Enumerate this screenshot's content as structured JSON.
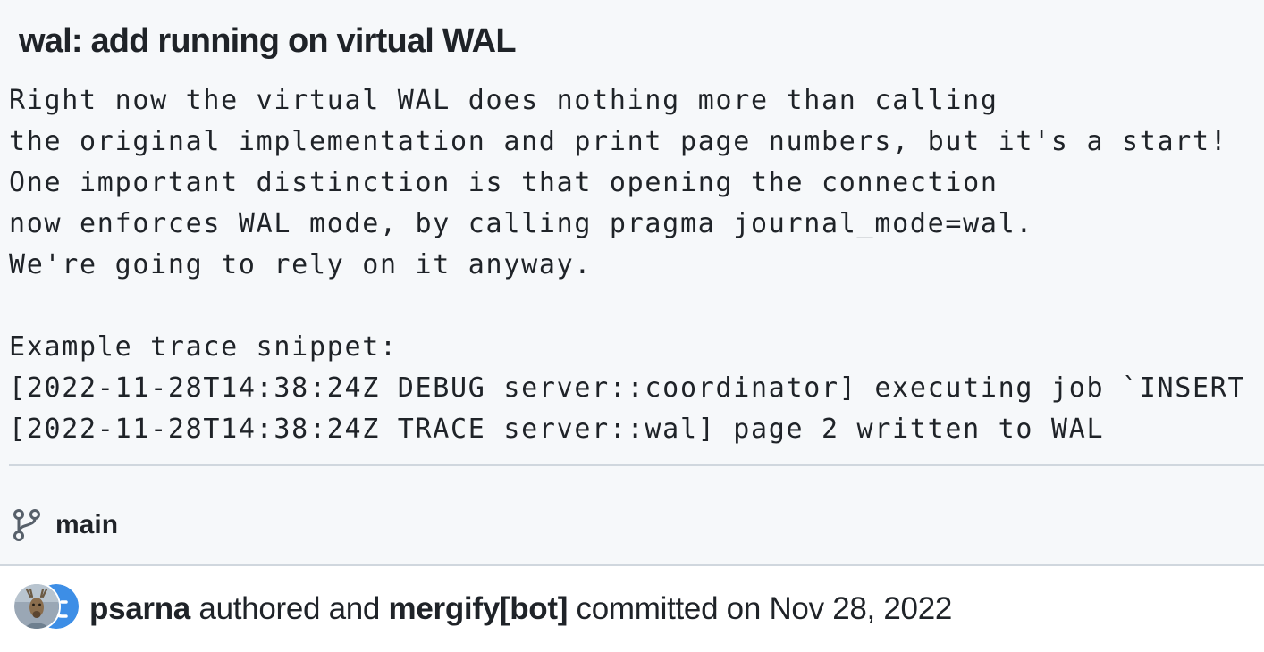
{
  "commit": {
    "title": "wal: add running on virtual WAL",
    "description_lines": [
      "Right now the virtual WAL does nothing more than calling",
      "the original implementation and print page numbers, but it's a start!",
      "One important distinction is that opening the connection",
      "now enforces WAL mode, by calling pragma journal_mode=wal.",
      "We're going to rely on it anyway.",
      "",
      "Example trace snippet:",
      "[2022-11-28T14:38:24Z DEBUG server::coordinator] executing job `INSERT",
      "[2022-11-28T14:38:24Z TRACE server::wal] page 2 written to WAL"
    ],
    "branch": "main",
    "author": "psarna",
    "authored_text": " authored and ",
    "committer": "mergify[bot]",
    "committed_text": " committed on ",
    "date": "Nov 28, 2022"
  },
  "icons": {
    "branch": "git-branch-icon",
    "author_avatar": "psarna-avatar",
    "committer_avatar": "mergify-bot-avatar"
  },
  "colors": {
    "header_background": "#f6f8fa",
    "author_bar_background": "#ffffff",
    "border": "#d0d7de",
    "text": "#1f2328",
    "mergify_blue": "#3d8ee6"
  }
}
